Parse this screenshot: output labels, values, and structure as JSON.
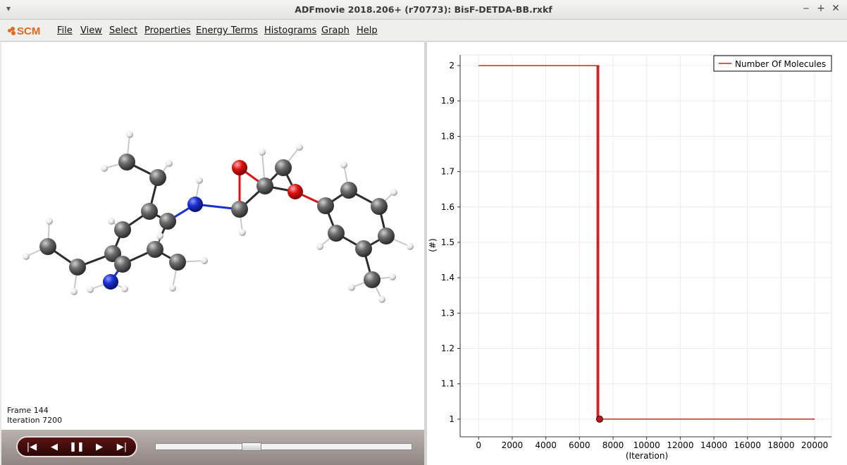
{
  "window": {
    "title": "ADFmovie 2018.206+ (r70773): BisF-DETDA-BB.rxkf",
    "buttons": [
      "minimize-icon",
      "maximize-icon",
      "close-icon"
    ]
  },
  "menubar": {
    "logo": "SCM",
    "items": [
      {
        "id": "file",
        "label": "File"
      },
      {
        "id": "view",
        "label": "View"
      },
      {
        "id": "select",
        "label": "Select"
      },
      {
        "id": "properties",
        "label": "Properties"
      },
      {
        "id": "energy-terms",
        "label": "Energy Terms"
      },
      {
        "id": "histograms",
        "label": "Histograms"
      },
      {
        "id": "graph",
        "label": "Graph"
      },
      {
        "id": "help",
        "label": "Help"
      }
    ]
  },
  "viewer": {
    "frame_label": "Frame 144",
    "iteration_label": "Iteration 7200",
    "colors": {
      "carbon": "#5a5a5a",
      "hydrogen": "#f2f2f2",
      "nitrogen": "#1a2fd0",
      "oxygen": "#e11111"
    }
  },
  "player": {
    "buttons": [
      "skip-to-start-icon",
      "step-back-icon",
      "pause-icon",
      "play-icon",
      "skip-to-end-icon"
    ],
    "slider_position": 0.36
  },
  "chart_data": {
    "type": "line",
    "legend": "Number Of Molecules",
    "legend_position": "top-right",
    "xlabel": "(Iteration)",
    "ylabel": "(#)",
    "xlim": [
      -1100,
      21000
    ],
    "ylim": [
      0.95,
      2.03
    ],
    "xticks": [
      0,
      2000,
      4000,
      6000,
      8000,
      10000,
      12000,
      14000,
      16000,
      18000,
      20000
    ],
    "yticks": [
      "1",
      "1.1",
      "1.2",
      "1.3",
      "1.4",
      "1.5",
      "1.6",
      "1.7",
      "1.8",
      "1.9",
      "2"
    ],
    "grid": true,
    "series": [
      {
        "name": "Number Of Molecules",
        "color": "#d42020",
        "x": [
          0,
          7050,
          7050,
          7100,
          7100,
          7150,
          7150,
          7200,
          7200,
          20000
        ],
        "y": [
          2,
          2,
          1,
          1,
          2,
          2,
          1,
          1,
          1,
          1
        ]
      }
    ],
    "marker": {
      "x": 7200,
      "y": 1
    }
  }
}
